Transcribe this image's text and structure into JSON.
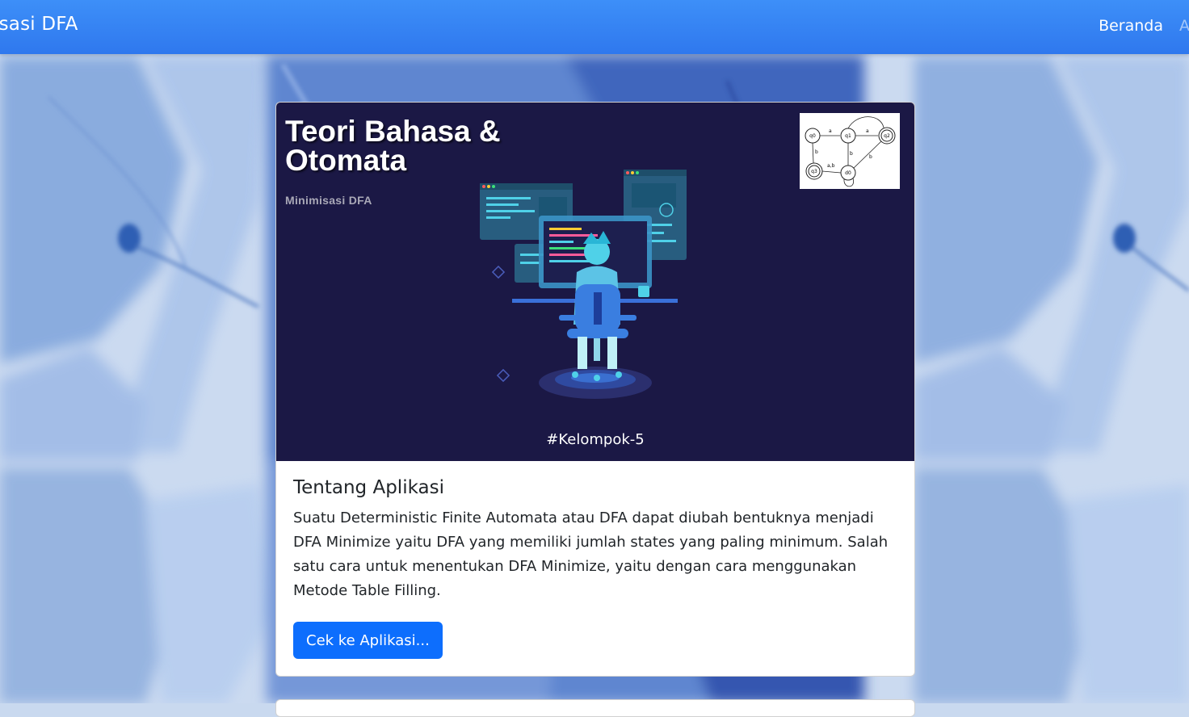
{
  "navbar": {
    "brand": "isasi DFA",
    "links": [
      "Beranda",
      "A"
    ]
  },
  "hero": {
    "title": "Teori Bahasa & Otomata",
    "subtitle": "Minimisasi DFA",
    "tag": "#Kelompok-5"
  },
  "about": {
    "title": "Tentang Aplikasi",
    "text": "Suatu Deterministic Finite Automata atau DFA dapat diubah bentuknya menjadi DFA Minimize yaitu DFA yang memiliki jumlah states yang paling minimum. Salah satu cara untuk menentukan DFA Minimize, yaitu dengan cara menggunakan Metode Table Filling.",
    "button": "Cek ke Aplikasi..."
  },
  "diagram": {
    "states": [
      "q0",
      "q1",
      "q2",
      "q3",
      "d0"
    ],
    "edge_labels": [
      "a",
      "a",
      "b",
      "b",
      "b",
      "a,b"
    ]
  },
  "colors": {
    "navbar": "#3d8ff8",
    "hero_bg": "#1b1845",
    "button": "#0d6efd",
    "accent": "#26c6da"
  }
}
